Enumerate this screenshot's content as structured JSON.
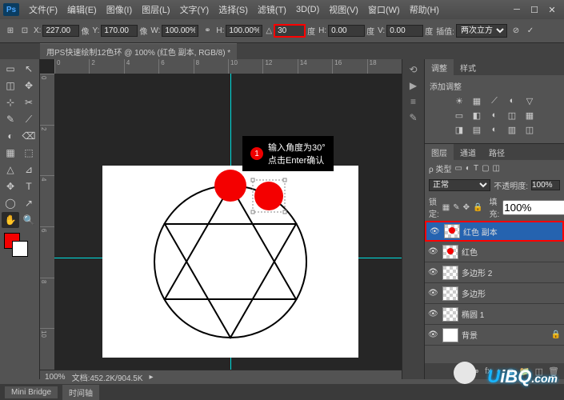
{
  "menubar": {
    "logo": "Ps",
    "items": [
      "文件(F)",
      "编辑(E)",
      "图像(I)",
      "图层(L)",
      "文字(Y)",
      "选择(S)",
      "滤镜(T)",
      "3D(D)",
      "视图(V)",
      "窗口(W)",
      "帮助(H)"
    ]
  },
  "optionsbar": {
    "x_label": "X:",
    "x_value": "227.00",
    "y_label": "Y:",
    "y_value": "170.00",
    "w_label": "W:",
    "w_value": "100.00%",
    "h_label": "H:",
    "h_value": "100.00%",
    "angle_label": "△",
    "angle_value": "30",
    "angle_unit": "度",
    "skew_h_label": "H:",
    "skew_h_value": "0.00",
    "skew_h_unit": "度",
    "skew_v_label": "V:",
    "skew_v_value": "0.00",
    "skew_v_unit": "度",
    "interp_label": "插值:",
    "interp_value": "两次立方",
    "px_unit": "像"
  },
  "document": {
    "tab_title": "用PS快速绘制12色环 @ 100% (红色 副本, RGB/8) *"
  },
  "rulers": {
    "h": [
      "0",
      "2",
      "4",
      "6",
      "8",
      "10",
      "12",
      "14",
      "16",
      "18"
    ],
    "v": [
      "0",
      "2",
      "4",
      "6",
      "8",
      "10"
    ]
  },
  "annotation": {
    "num": "1",
    "line1": "输入角度为30°",
    "line2": "点击Enter确认"
  },
  "adjustments": {
    "tab1": "调整",
    "tab2": "样式",
    "title": "添加调整"
  },
  "layers": {
    "tab1": "图层",
    "tab2": "通道",
    "tab3": "路径",
    "kind_label": "ρ 类型",
    "blend_mode": "正常",
    "opacity_label": "不透明度:",
    "opacity_value": "100%",
    "lock_label": "锁定:",
    "fill_label": "填充:",
    "fill_value": "100%",
    "items": [
      {
        "name": "红色 副本",
        "selected": true,
        "thumb": "circle"
      },
      {
        "name": "红色",
        "selected": false,
        "thumb": "circle"
      },
      {
        "name": "多边形 2",
        "selected": false,
        "thumb": "checker"
      },
      {
        "name": "多边形",
        "selected": false,
        "thumb": "checker"
      },
      {
        "name": "椭圆 1",
        "selected": false,
        "thumb": "checker"
      },
      {
        "name": "背景",
        "selected": false,
        "thumb": "solid",
        "locked": true
      }
    ]
  },
  "statusbar": {
    "zoom": "100%",
    "docinfo": "文档:452.2K/904.5K"
  },
  "bottombar": {
    "tab1": "Mini Bridge",
    "tab2": "时间轴"
  },
  "watermark": {
    "text": "UiBQ.com"
  },
  "tools": [
    "▭",
    "↖",
    "◫",
    "✥",
    "⊹",
    "✂",
    "✎",
    "⟋",
    "◐",
    "⌫",
    "▦",
    "⬚",
    "△",
    "⊿",
    "✥",
    "T",
    "◯",
    "↗",
    "✋",
    "🔍"
  ],
  "dock_icons": [
    "⟲",
    "▶",
    "≡",
    "✎"
  ]
}
